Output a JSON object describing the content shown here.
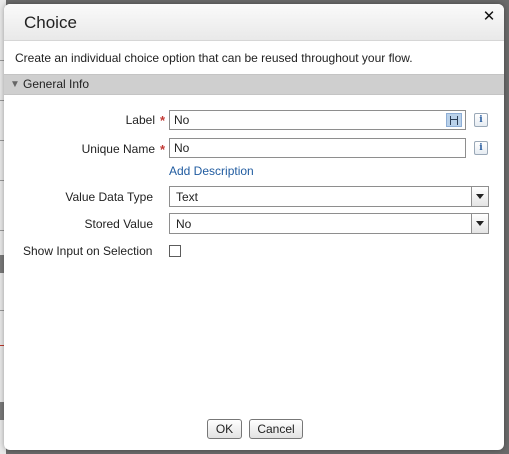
{
  "dialog": {
    "title": "Choice",
    "close_icon": "close-icon",
    "description": "Create an individual choice option that can be reused throughout your flow."
  },
  "section": {
    "title": "General Info",
    "icon": "triangle-down-icon"
  },
  "fields": {
    "label": {
      "label": "Label",
      "value": "No",
      "required": true
    },
    "unique_name": {
      "label": "Unique Name",
      "value": "No",
      "required": true
    },
    "add_description": "Add Description",
    "value_data_type": {
      "label": "Value Data Type",
      "value": "Text"
    },
    "stored_value": {
      "label": "Stored Value",
      "value": "No"
    },
    "show_input": {
      "label": "Show Input on Selection",
      "checked": false
    }
  },
  "required_marker": "*",
  "info_icon_glyph": "i",
  "buttons": {
    "ok": "OK",
    "cancel": "Cancel"
  }
}
